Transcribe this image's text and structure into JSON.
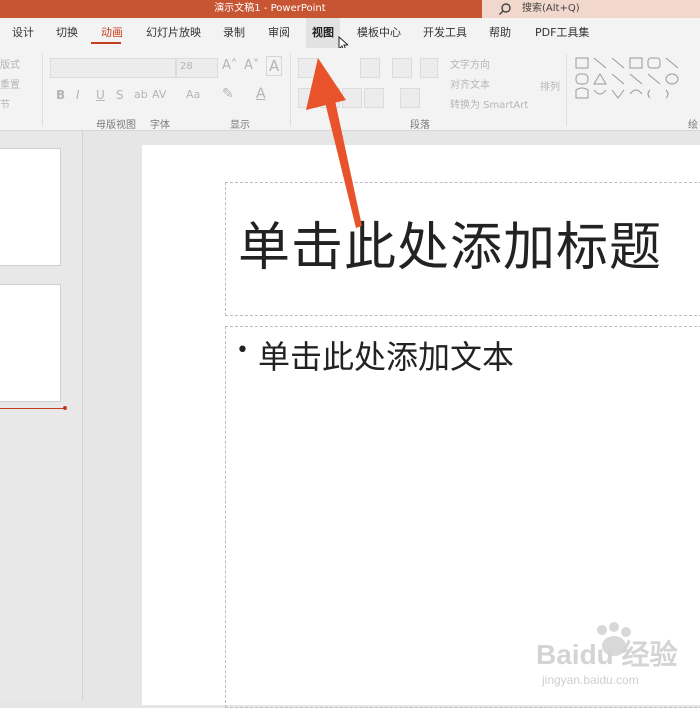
{
  "app": {
    "title": "演示文稿1  -  PowerPoint",
    "search": "搜索(Alt+Q)"
  },
  "ribbon": {
    "tabs": [
      {
        "label": "设计"
      },
      {
        "label": "切换"
      },
      {
        "label": "动画"
      },
      {
        "label": "幻灯片放映"
      },
      {
        "label": "录制"
      },
      {
        "label": "审阅"
      },
      {
        "label": "视图"
      },
      {
        "label": "模板中心"
      },
      {
        "label": "开发工具"
      },
      {
        "label": "帮助"
      },
      {
        "label": "PDF工具集"
      }
    ],
    "active_tab": "动画",
    "hovered_tab": "视图",
    "left_edge_labels": [
      "版式",
      "重置",
      "节"
    ],
    "font_size_value": "28",
    "text_buttons": {
      "text_direction": "文字方向",
      "align_text": "对齐文本",
      "convert_smartart": "转换为 SmartArt",
      "arrange": "排列"
    },
    "groups": {
      "font": "字体",
      "paragraph": "段落",
      "template_view": "母版视图",
      "display": "显示",
      "drawing": "绘"
    },
    "colors": {
      "accent": "#c43e1c",
      "titlebar": "#c75533",
      "arrow": "#e8532b"
    }
  },
  "slide": {
    "title_placeholder": "单击此处添加标题",
    "body_placeholder": "单击此处添加文本",
    "bullet": "•"
  },
  "watermark": {
    "brand": "Baidu 经验",
    "url": "jingyan.baidu.com"
  }
}
